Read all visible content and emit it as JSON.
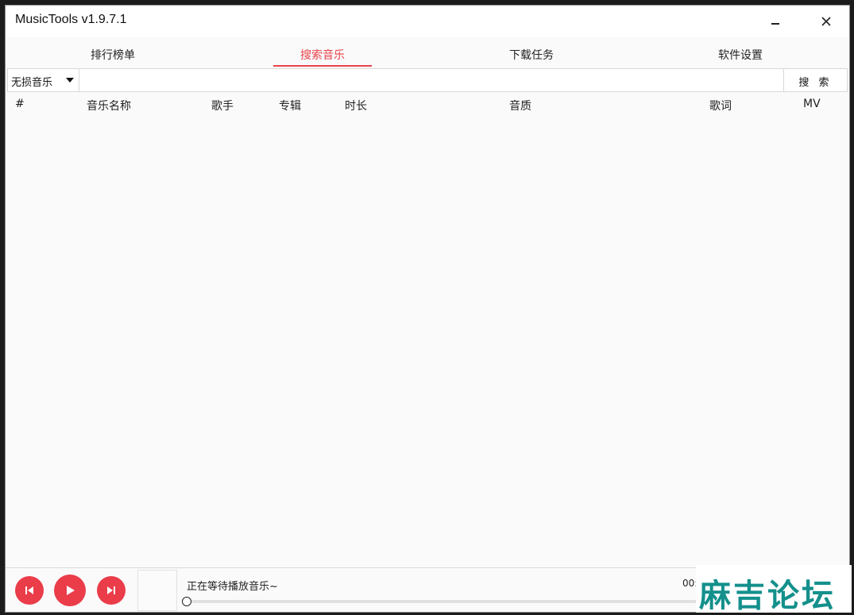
{
  "window": {
    "title": "MusicTools v1.9.7.1"
  },
  "tabs": [
    {
      "label": "排行榜单",
      "active": false
    },
    {
      "label": "搜索音乐",
      "active": true
    },
    {
      "label": "下载任务",
      "active": false
    },
    {
      "label": "软件设置",
      "active": false
    }
  ],
  "search": {
    "source_selected": "无损音乐",
    "placeholder": "",
    "value": "",
    "button_label": "搜 索"
  },
  "table": {
    "columns": [
      "#",
      "音乐名称",
      "歌手",
      "专辑",
      "时长",
      "音质",
      "歌词",
      "MV"
    ],
    "rows": []
  },
  "player": {
    "status_text": "正在等待播放音乐~",
    "time_text": "00:00",
    "progress": 0
  },
  "watermark": {
    "text": "麻吉论坛"
  },
  "colors": {
    "accent": "#e8434b",
    "player_button": "#ea3c49",
    "watermark": "#14908c"
  }
}
